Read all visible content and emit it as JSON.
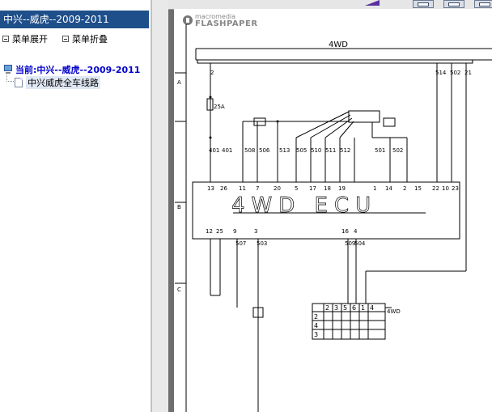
{
  "sidebar": {
    "title": "中兴--威虎--2009-2011",
    "expand_label": "菜单展开",
    "collapse_label": "菜单折叠",
    "root_label": "当前:中兴--威虎--2009-2011",
    "child_label": "中兴威虎全车线路"
  },
  "viewer": {
    "logo_brand": "macromedia",
    "logo_product": "FLASHPAPER"
  },
  "diagram": {
    "bus_label": "4WD",
    "ecu_label": "4WD ECU",
    "fuse_label": "25A",
    "top_wires": [
      "2",
      "514",
      "502",
      "21"
    ],
    "ecu_top_wires": [
      "401",
      "401",
      "508",
      "506",
      "513",
      "505",
      "510",
      "511",
      "512",
      "501",
      "502"
    ],
    "ecu_top_pins": [
      "13",
      "26",
      "11",
      "7",
      "20",
      "5",
      "17",
      "18",
      "19",
      "1",
      "14",
      "2",
      "15",
      "22",
      "10",
      "23"
    ],
    "ecu_bottom_pins": [
      "12",
      "25",
      "9",
      "3",
      "16",
      "4"
    ],
    "bottom_wires": [
      "507",
      "503",
      "509",
      "504"
    ],
    "switch_cols": [
      "2",
      "3",
      "5",
      "6",
      "1",
      "4"
    ],
    "switch_rows": [
      "2",
      "4",
      "3"
    ],
    "switch_label": "4WD",
    "left_ticks": [
      "A",
      "B",
      "C"
    ],
    "colors": {
      "line": "#000000",
      "title_bg": "#1f4f8a",
      "page_bg": "#ffffff"
    }
  }
}
